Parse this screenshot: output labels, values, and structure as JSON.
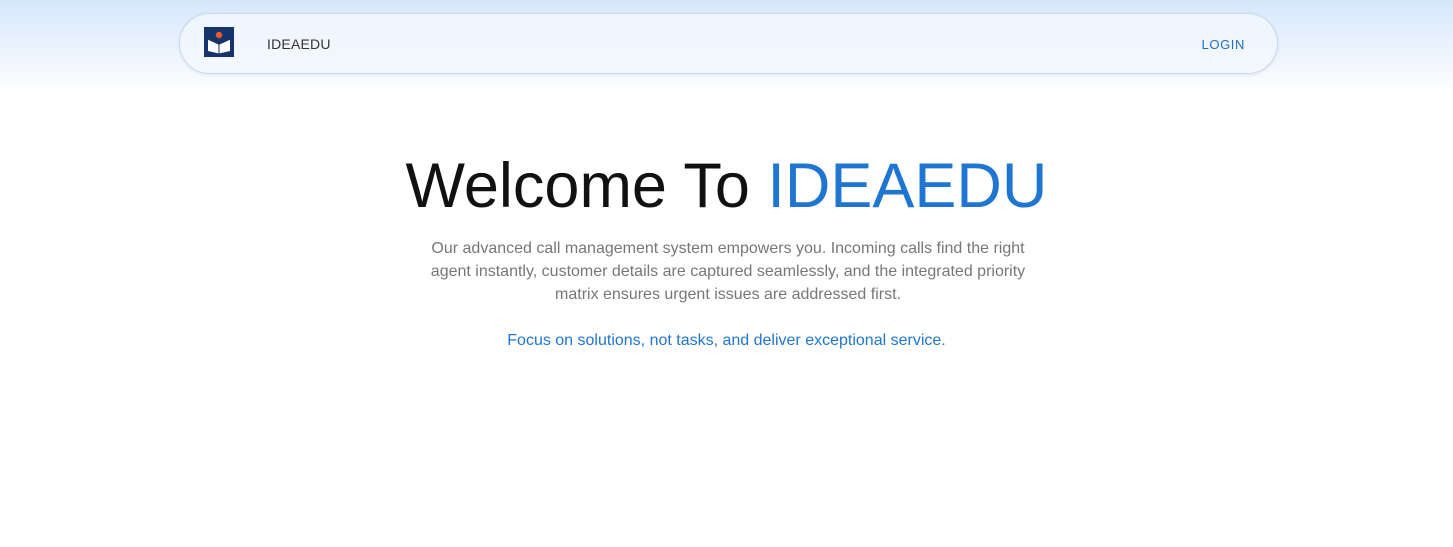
{
  "navbar": {
    "brand": "IDEAEDU",
    "login_label": "LOGIN",
    "logo_icon": "book-logo-icon"
  },
  "hero": {
    "title_prefix": "Welcome To ",
    "title_accent": "IDEAEDU",
    "description": "Our advanced call management system empowers you. Incoming calls find the right agent instantly, customer details are captured seamlessly, and the integrated priority matrix ensures urgent issues are addressed first.",
    "tagline": "Focus on solutions, not tasks, and deliver exceptional service."
  },
  "colors": {
    "accent": "#1f76d2",
    "logo_navy": "#16336b",
    "logo_orange": "#f05a28",
    "text_muted": "#777777"
  }
}
